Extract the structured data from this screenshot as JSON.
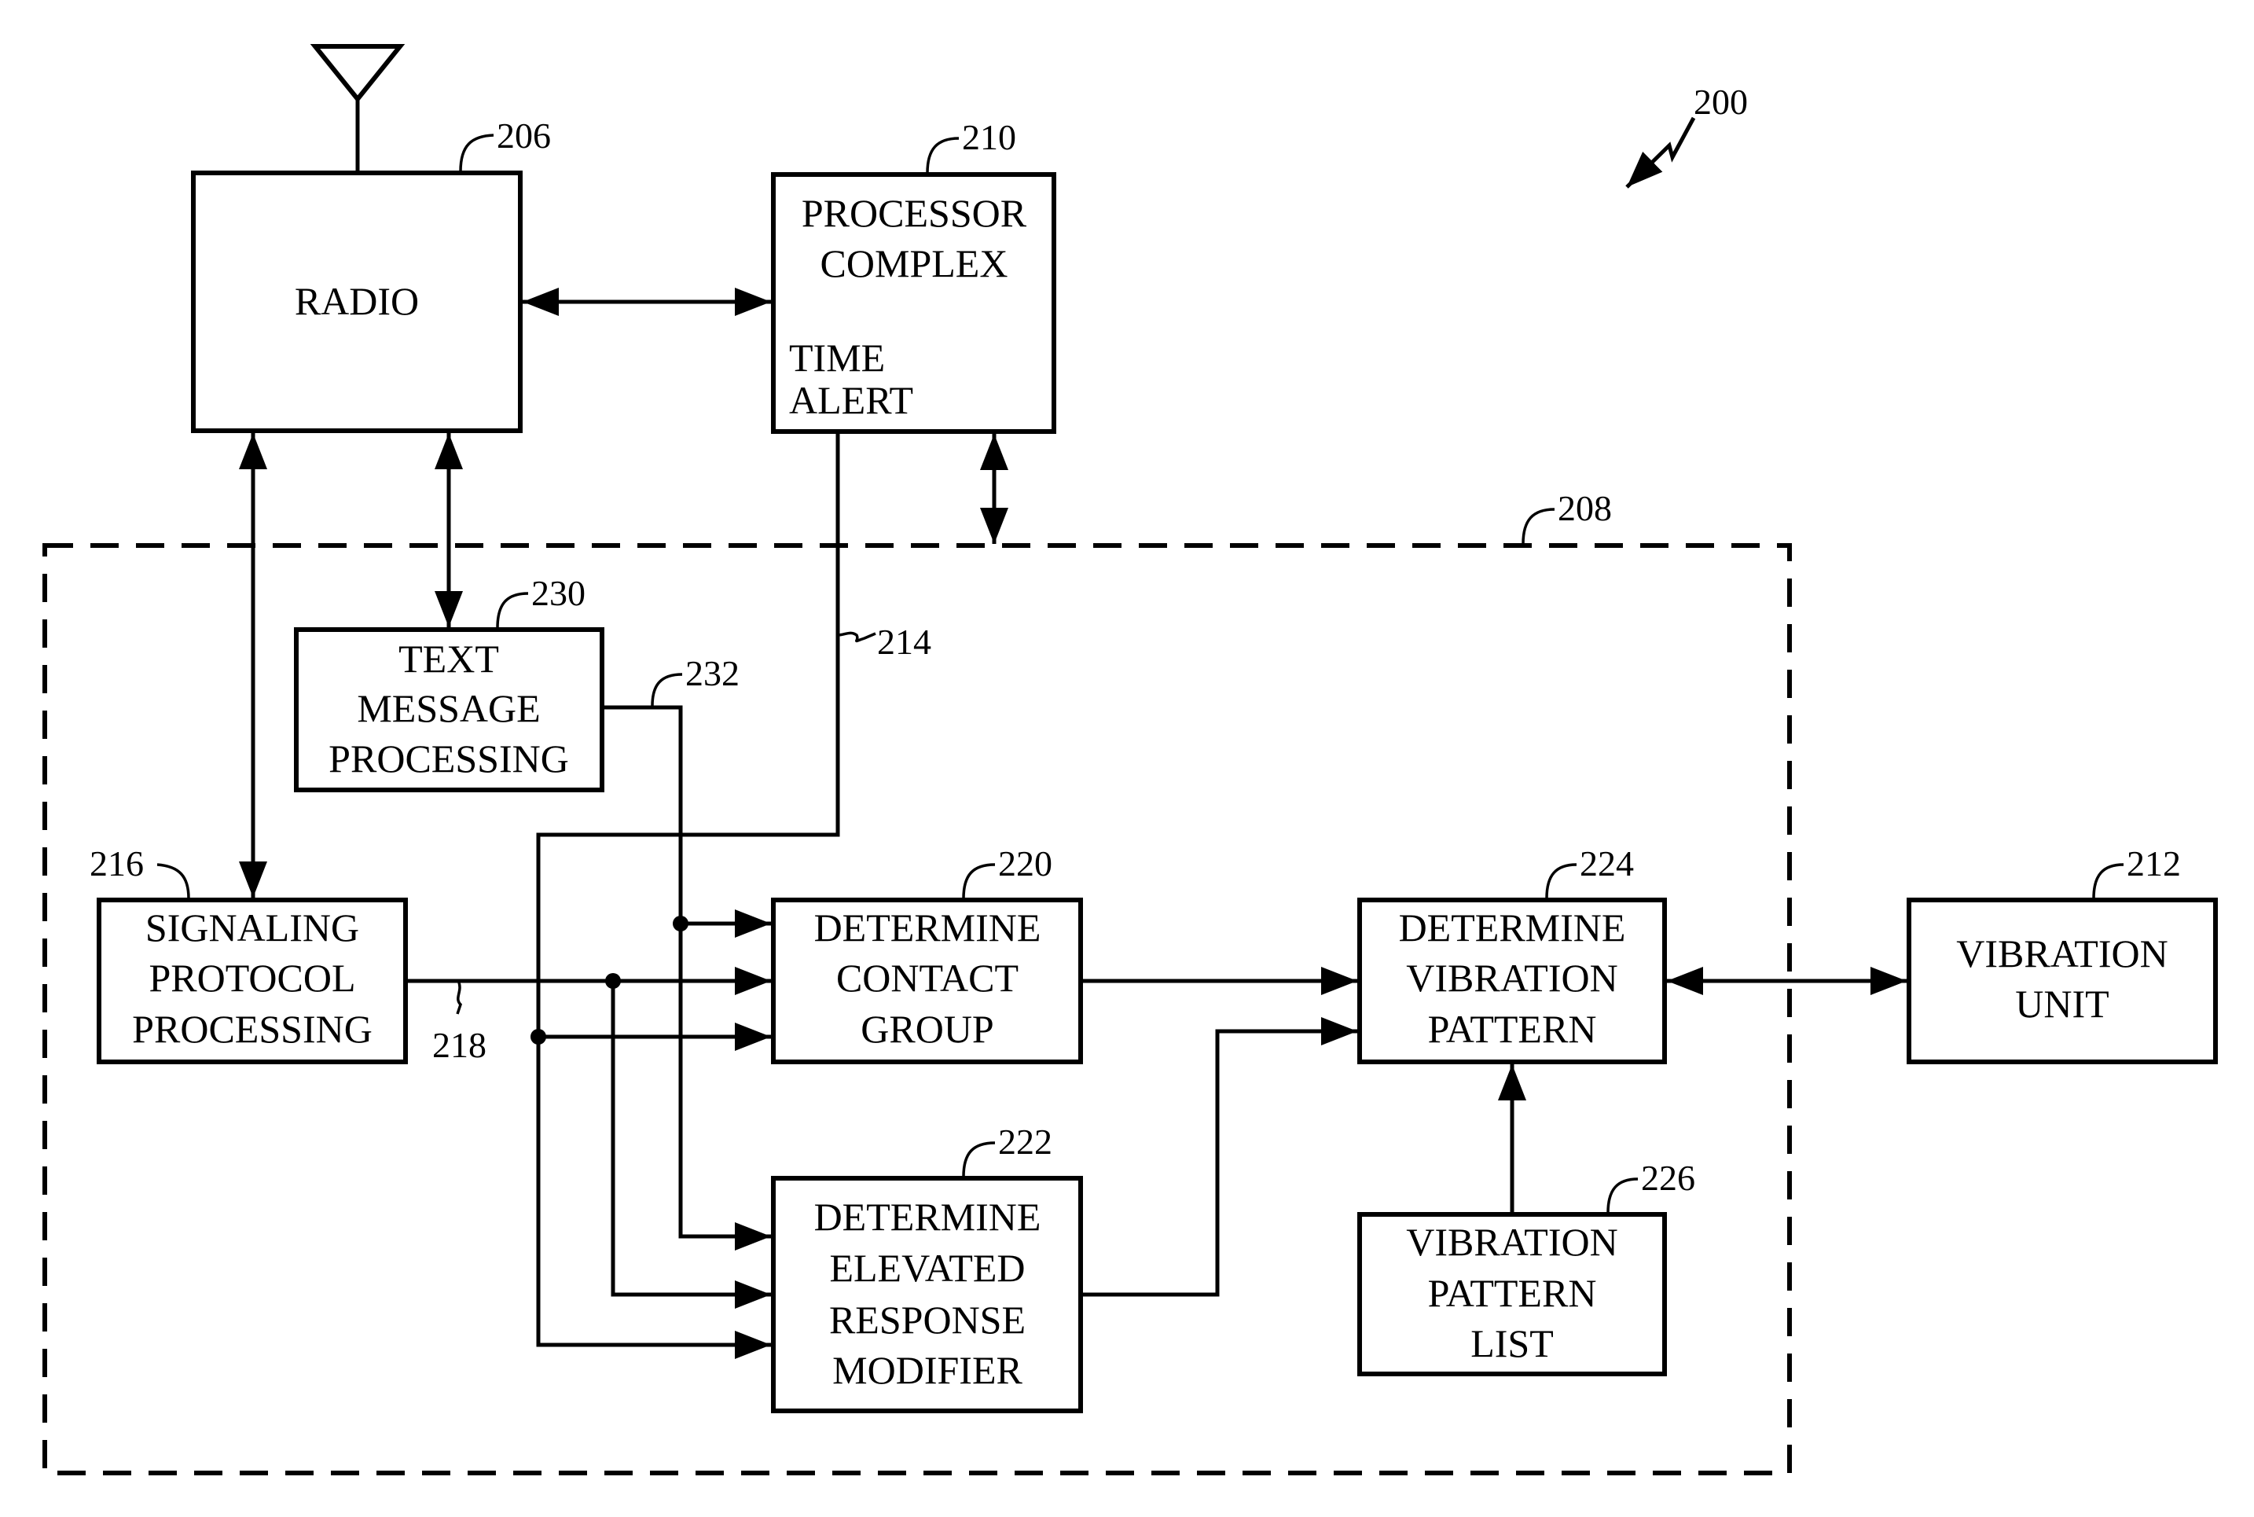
{
  "figure": {
    "reference": "200"
  },
  "blocks": {
    "radio": {
      "ref": "206",
      "lines": [
        "RADIO"
      ]
    },
    "processor": {
      "ref": "210",
      "lines": [
        "PROCESSOR",
        "COMPLEX"
      ],
      "sub_lines": [
        "TIME",
        "ALERT"
      ]
    },
    "subsystem": {
      "ref": "208"
    },
    "text_message": {
      "ref": "230",
      "lines": [
        "TEXT",
        "MESSAGE",
        "PROCESSING"
      ]
    },
    "signaling": {
      "ref": "216",
      "lines": [
        "SIGNALING",
        "PROTOCOL",
        "PROCESSING"
      ]
    },
    "contact_group": {
      "ref": "220",
      "lines": [
        "DETERMINE",
        "CONTACT",
        "GROUP"
      ]
    },
    "elevated": {
      "ref": "222",
      "lines": [
        "DETERMINE",
        "ELEVATED",
        "RESPONSE",
        "MODIFIER"
      ]
    },
    "vibration_pattern": {
      "ref": "224",
      "lines": [
        "DETERMINE",
        "VIBRATION",
        "PATTERN"
      ]
    },
    "pattern_list": {
      "ref": "226",
      "lines": [
        "VIBRATION",
        "PATTERN",
        "LIST"
      ]
    },
    "vibration_unit": {
      "ref": "212",
      "lines": [
        "VIBRATION",
        "UNIT"
      ]
    }
  },
  "signals": {
    "time_alert_line": {
      "ref": "214"
    },
    "signaling_line": {
      "ref": "218"
    },
    "text_line": {
      "ref": "232"
    }
  }
}
